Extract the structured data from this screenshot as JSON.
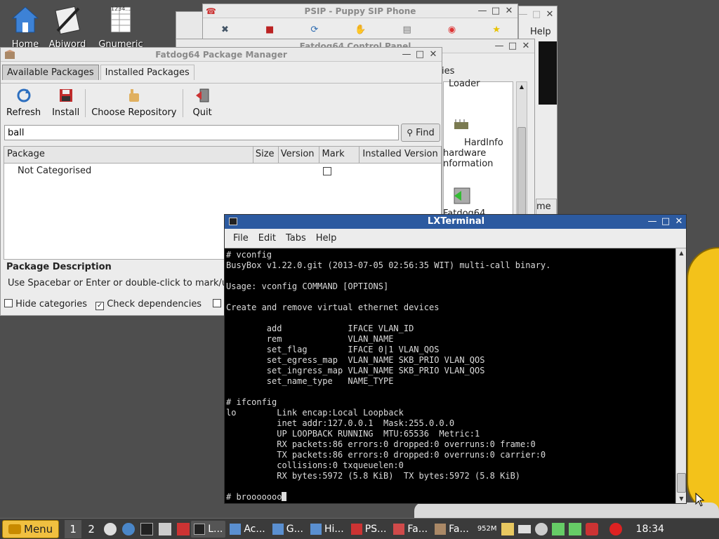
{
  "desktop": {
    "icons": [
      {
        "label": "Home"
      },
      {
        "label": "Abiword"
      },
      {
        "label": "Gnumeric"
      }
    ],
    "gnumeric_badge": "1234..."
  },
  "psip": {
    "title": "PSIP - Puppy SIP Phone",
    "help": "Help"
  },
  "control_panel": {
    "title": "Fatdog64 Control Panel",
    "tab_partial": "ies",
    "items": [
      "Loader",
      "HardInfo",
      "hardware",
      "nformation",
      "Fatdog64"
    ],
    "me_partial": "me"
  },
  "pkg": {
    "title": "Fatdog64 Package Manager",
    "tabs": [
      "Available Packages",
      "Installed Packages"
    ],
    "toolbar": {
      "refresh": "Refresh",
      "install": "Install",
      "choose_repo": "Choose Repository",
      "quit": "Quit"
    },
    "search_value": "ball",
    "find": "Find",
    "columns": [
      "Package",
      "Size",
      "Version",
      "Mark",
      "Installed Version"
    ],
    "row": "Not Categorised",
    "desc_title": "Package Description",
    "desc_text": "Use Spacebar or Enter or double-click to mark/u",
    "hide_categories": "Hide categories",
    "check_dependencies": "Check dependencies"
  },
  "terminal": {
    "title": "LXTerminal",
    "menu": [
      "File",
      "Edit",
      "Tabs",
      "Help"
    ],
    "lines": [
      "# vconfig",
      "BusyBox v1.22.0.git (2013-07-05 02:56:35 WIT) multi-call binary.",
      "",
      "Usage: vconfig COMMAND [OPTIONS]",
      "",
      "Create and remove virtual ethernet devices",
      "",
      "        add             IFACE VLAN_ID",
      "        rem             VLAN_NAME",
      "        set_flag        IFACE 0|1 VLAN_QOS",
      "        set_egress_map  VLAN_NAME SKB_PRIO VLAN_QOS",
      "        set_ingress_map VLAN_NAME SKB_PRIO VLAN_QOS",
      "        set_name_type   NAME_TYPE",
      "",
      "# ifconfig",
      "lo        Link encap:Local Loopback",
      "          inet addr:127.0.0.1  Mask:255.0.0.0",
      "          UP LOOPBACK RUNNING  MTU:65536  Metric:1",
      "          RX packets:86 errors:0 dropped:0 overruns:0 frame:0",
      "          TX packets:86 errors:0 dropped:0 overruns:0 carrier:0",
      "          collisions:0 txqueuelen:0",
      "          RX bytes:5972 (5.8 KiB)  TX bytes:5972 (5.8 KiB)",
      "",
      "# brooooooo"
    ]
  },
  "taskbar": {
    "menu": "Menu",
    "desktops": [
      "1",
      "2"
    ],
    "tasks": [
      "L...",
      "Ac...",
      "G...",
      "Hi...",
      "PS...",
      "Fa...",
      "Fa..."
    ],
    "mem": "952M",
    "clock": "18:34"
  },
  "colors": {
    "accent_blue": "#2c5aa0",
    "taskbar": "#3b3b3b",
    "menu_button": "#f0c040"
  }
}
